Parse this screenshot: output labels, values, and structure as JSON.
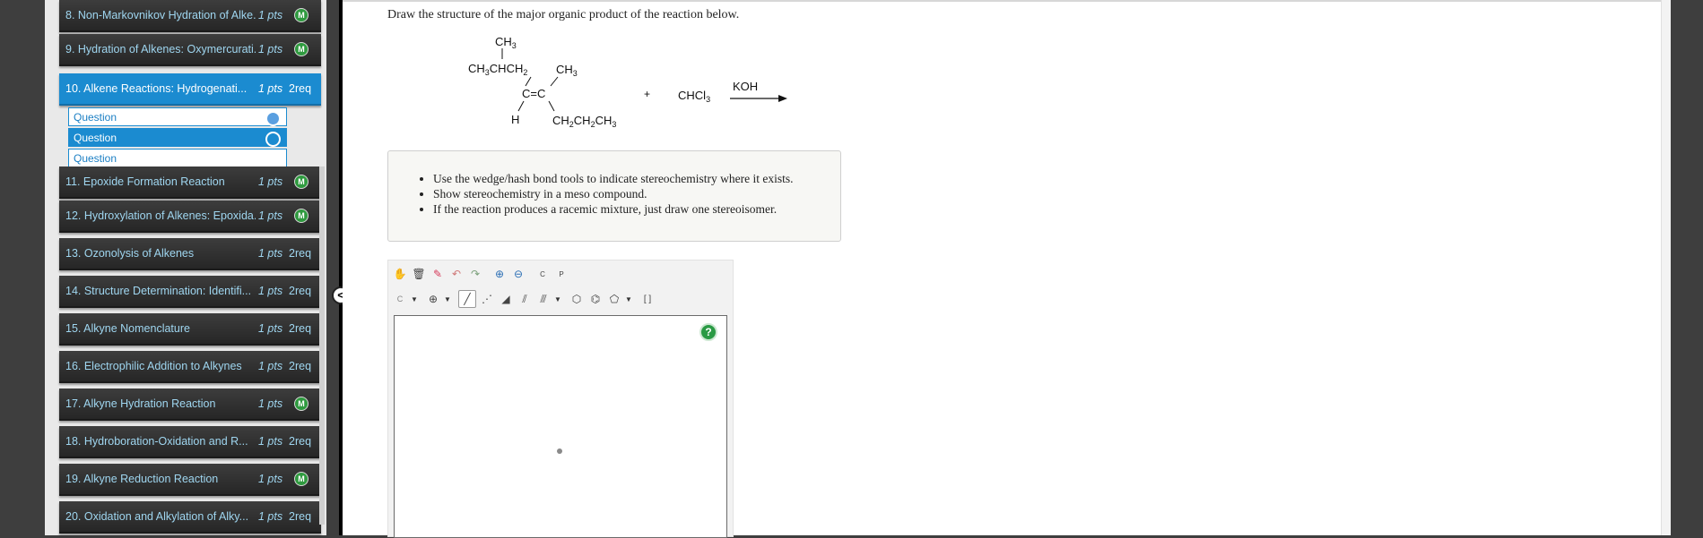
{
  "sidebar": {
    "items": [
      {
        "title": "8. Non-Markovnikov Hydration of Alke...",
        "pts": "1 pts",
        "badge": "M"
      },
      {
        "title": "9. Hydration of Alkenes: Oxymercurati...",
        "pts": "1 pts",
        "badge": "M"
      },
      {
        "title": "10. Alkene Reactions: Hydrogenati...",
        "pts": "1 pts",
        "req": "2req",
        "active": true,
        "subitems": [
          "Question",
          "Question",
          "Question"
        ]
      },
      {
        "title": "11. Epoxide Formation Reaction",
        "pts": "1 pts",
        "badge": "M"
      },
      {
        "title": "12. Hydroxylation of Alkenes: Epoxida...",
        "pts": "1 pts",
        "badge": "M"
      },
      {
        "title": "13. Ozonolysis of Alkenes",
        "pts": "1 pts",
        "req": "2req"
      },
      {
        "title": "14. Structure Determination: Identifi...",
        "pts": "1 pts",
        "req": "2req"
      },
      {
        "title": "15. Alkyne Nomenclature",
        "pts": "1 pts",
        "req": "2req"
      },
      {
        "title": "16. Electrophilic Addition to Alkynes",
        "pts": "1 pts",
        "req": "2req"
      },
      {
        "title": "17. Alkyne Hydration Reaction",
        "pts": "1 pts",
        "badge": "M"
      },
      {
        "title": "18. Hydroboration-Oxidation and R...",
        "pts": "1 pts",
        "req": "2req"
      },
      {
        "title": "19. Alkyne Reduction Reaction",
        "pts": "1 pts",
        "badge": "M"
      },
      {
        "title": "20. Oxidation and Alkylation of Alky...",
        "pts": "1 pts",
        "req": "2req"
      }
    ],
    "collapse_label": "<"
  },
  "question": {
    "prompt": "Draw the structure of the major organic product of the reaction below.",
    "reaction": {
      "top_methyl": "CH3",
      "left_substituent": "CH3CHCH2",
      "right_top": "CH3",
      "double_bond": "C=C",
      "left_bottom": "H",
      "right_bottom": "CH2CH2CH3",
      "plus": "+",
      "reagent": "CHCl3",
      "condition": "KOH"
    },
    "instructions": [
      "Use the wedge/hash bond tools to indicate stereochemistry where it exists.",
      "Show stereochemistry in a meso compound.",
      "If the reaction produces a racemic mixture, just draw one stereoisomer."
    ]
  },
  "editor": {
    "element_selector": "C",
    "help_label": "?",
    "copy_label": "C",
    "paste_label": "P",
    "colors": {
      "accent": "#1b8bd0",
      "help_green": "#2a9a44"
    }
  }
}
